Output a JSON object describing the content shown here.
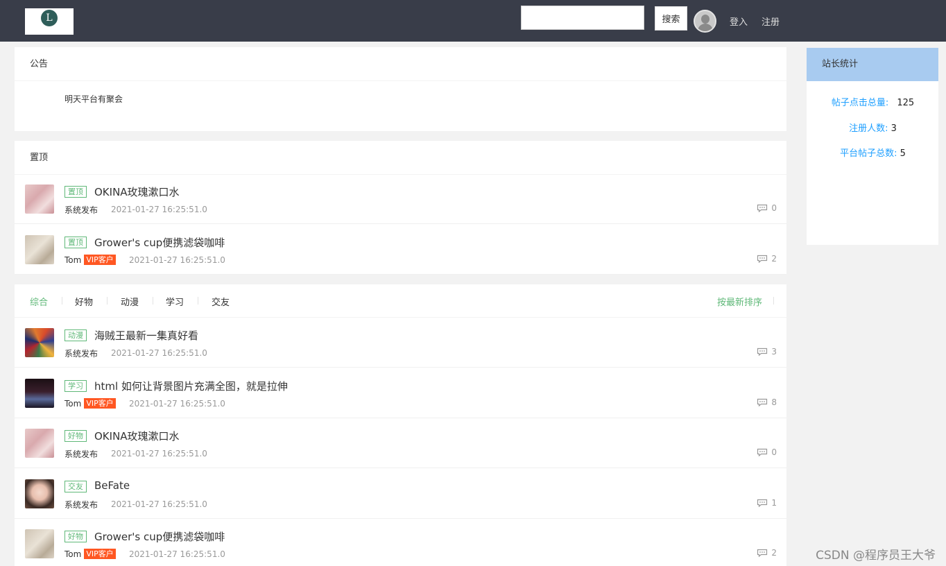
{
  "header": {
    "logo_text": "L",
    "search_placeholder": "",
    "search_button": "搜索",
    "login": "登入",
    "register": "注册"
  },
  "notice": {
    "title": "公告",
    "content": "明天平台有聚会"
  },
  "pinned": {
    "title": "置顶",
    "posts": [
      {
        "tag": "置顶",
        "title": "OKINA玫瑰漱口水",
        "author": "系统发布",
        "vip": "",
        "time": "2021-01-27 16:25:51.0",
        "replies": "0",
        "thumb": "pink"
      },
      {
        "tag": "置顶",
        "title": "Grower's cup便携滤袋咖啡",
        "author": "Tom",
        "vip": "VIP客户",
        "time": "2021-01-27 16:25:51.0",
        "replies": "2",
        "thumb": "beige"
      }
    ]
  },
  "feed": {
    "tabs": [
      "综合",
      "好物",
      "动漫",
      "学习",
      "交友"
    ],
    "sort": "按最新排序",
    "posts": [
      {
        "tag": "动漫",
        "title": "海贼王最新一集真好看",
        "author": "系统发布",
        "vip": "",
        "time": "2021-01-27 16:25:51.0",
        "replies": "3",
        "thumb": "anime"
      },
      {
        "tag": "学习",
        "title": "html 如何让背景图片充满全图，就是拉伸",
        "author": "Tom",
        "vip": "VIP客户",
        "time": "2021-01-27 16:25:51.0",
        "replies": "8",
        "thumb": "dark"
      },
      {
        "tag": "好物",
        "title": "OKINA玫瑰漱口水",
        "author": "系统发布",
        "vip": "",
        "time": "2021-01-27 16:25:51.0",
        "replies": "0",
        "thumb": "pink"
      },
      {
        "tag": "交友",
        "title": "BeFate",
        "author": "系统发布",
        "vip": "",
        "time": "2021-01-27 16:25:51.0",
        "replies": "1",
        "thumb": "face"
      },
      {
        "tag": "好物",
        "title": "Grower's cup便携滤袋咖啡",
        "author": "Tom",
        "vip": "VIP客户",
        "time": "2021-01-27 16:25:51.0",
        "replies": "2",
        "thumb": "beige"
      }
    ]
  },
  "stats": {
    "title": "站长统计",
    "items": [
      {
        "label": "帖子点击总量:",
        "value": "125"
      },
      {
        "label": "注册人数:",
        "value": "3"
      },
      {
        "label": "平台帖子总数:",
        "value": "5"
      }
    ]
  },
  "watermark": "CSDN @程序员王大爷",
  "colors": {
    "header": "#393d49",
    "accent": "#5FB878",
    "vip": "#FF5722",
    "link": "#1E9FFF",
    "stats_header": "#a8cbf0"
  }
}
